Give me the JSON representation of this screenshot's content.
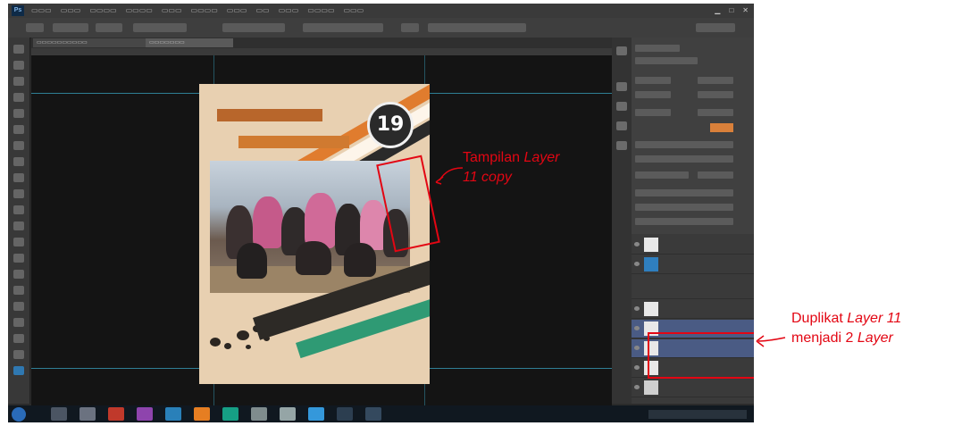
{
  "annotation_left": {
    "line1_plain": "Tampilan ",
    "line1_italic": "Layer",
    "line2_italic": "11 copy"
  },
  "annotation_right": {
    "line1_plain": "Duplikat ",
    "line1_italic": "Layer 11",
    "line2_plain": "menjadi 2 ",
    "line2_italic": "Layer"
  },
  "poster": {
    "badge_number": "19"
  },
  "colors": {
    "annotation_red": "#e30613",
    "selected_layer_blue": "#4a5b84",
    "photoshop_dark": "#2b2b2b"
  }
}
